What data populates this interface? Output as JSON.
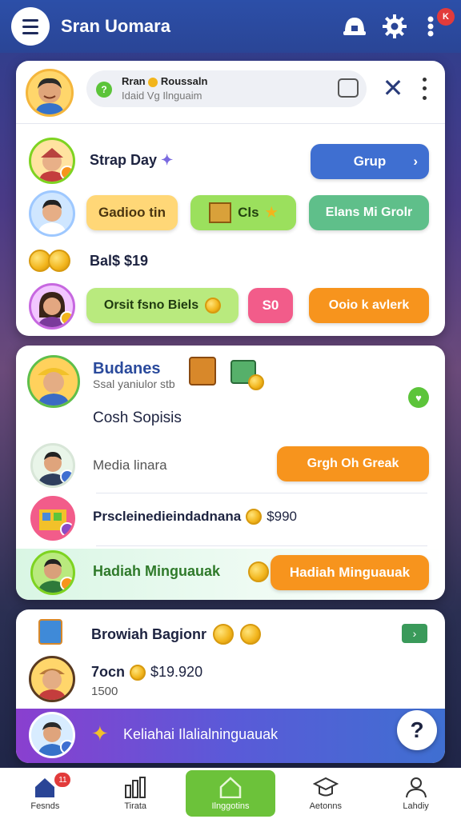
{
  "header": {
    "title": "Sran Uomara",
    "notifications_badge": "K"
  },
  "profile_card": {
    "user_name": "Rran",
    "user_subtitle": "Roussaln",
    "user_line2": "Idaid Vg  Ilnguaim"
  },
  "game_card": {
    "row1_title": "Strap Day",
    "row1_button": "Grup",
    "row2_btn1": "Gadioo tin",
    "row2_btn2": "Cls",
    "row2_btn3": "Elans Mi Grolr",
    "row3_balance": "Bal$ $19",
    "row4_btn1": "Orsit fsno Biels",
    "row4_btn2": "S0",
    "row4_btn3": "Ooio k avlerk"
  },
  "business_card": {
    "title": "Budanes",
    "subtitle": "Ssal yaniulor stb",
    "section": "Cosh Sopisis",
    "item1_label": "Media linara",
    "item1_button": "Grgh Oh Greak",
    "item2_label": "Prscleinedieindadnana",
    "item2_amount": "$990",
    "item3_label": "Hadiah Minguauak",
    "item3_button": "Hadiah Minguauak"
  },
  "rewards_card": {
    "title": "Browiah Bagionr",
    "amount_label": "7ocn",
    "amount_value": "$19.920",
    "amount_sub": "1500",
    "banner_text": "Keliahai Ilalialninguauak"
  },
  "bottom_nav": {
    "items": [
      {
        "label": "Fesnds",
        "badge": "11"
      },
      {
        "label": "Tirata"
      },
      {
        "label": "Ilnggotins"
      },
      {
        "label": "Aetonns"
      },
      {
        "label": "Lahdiy"
      }
    ]
  },
  "colors": {
    "primary_blue": "#3f6fd1",
    "green": "#7ed321",
    "orange": "#f7941d",
    "pink": "#f25c8a"
  }
}
